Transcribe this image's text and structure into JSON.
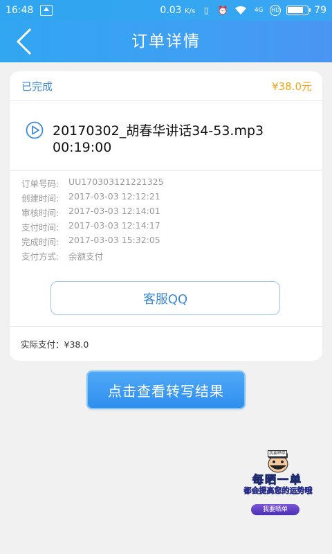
{
  "status_bar": {
    "time": "16:48",
    "speed": "0.03",
    "speed_unit": "K/s",
    "network": "4G",
    "battery": "79"
  },
  "header": {
    "title": "订单详情"
  },
  "order": {
    "status": "已完成",
    "price": "¥38.0元",
    "file_name": "20170302_胡春华讲话34-53.mp3",
    "duration": "00:19:00",
    "details": [
      {
        "label": "订单号码:",
        "value": "UU170303121221325"
      },
      {
        "label": "创建时间:",
        "value": "2017-03-03 12:12:21"
      },
      {
        "label": "审核时间:",
        "value": "2017-03-03 12:14:01"
      },
      {
        "label": "支付时间:",
        "value": "2017-03-03 12:14:17"
      },
      {
        "label": "完成时间:",
        "value": "2017-03-03 15:32:05"
      },
      {
        "label": "支付方式:",
        "value": "余额支付"
      }
    ],
    "support_button": "客服QQ",
    "total": "实际支付：¥38.0"
  },
  "view_button": "点击查看转写结果",
  "promo": {
    "badge": "我要晒单",
    "line1": "每晒一单",
    "line2": "都会提高您的运势哦",
    "button": "我要晒单"
  },
  "colors": {
    "accent": "#3d8ad8",
    "price": "#f4a413",
    "header": "#3aa6f2"
  }
}
